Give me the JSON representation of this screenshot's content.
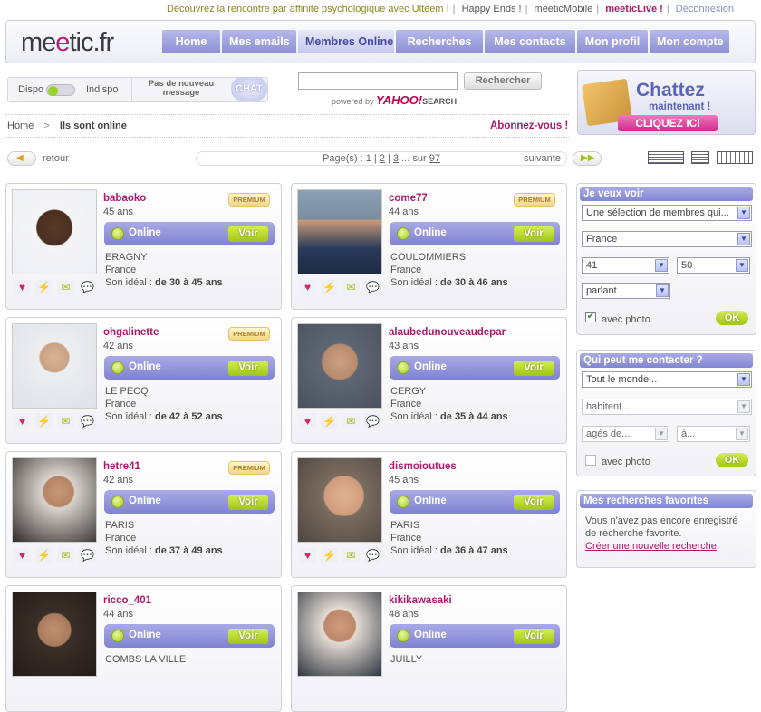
{
  "toplinks": {
    "promo": "Découvrez la rencontre par affinité psychologique avec Ulteem !",
    "happy_ends": "Happy Ends !",
    "mobile": "meeticMobile",
    "live": "meeticLive !",
    "logout": "Déconnexion"
  },
  "logo": {
    "part1": "me",
    "e": "e",
    "part2": "tic.fr"
  },
  "nav": [
    "Home",
    "Mes emails",
    "Membres Online",
    "Recherches",
    "Mes contacts",
    "Mon profil",
    "Mon compte"
  ],
  "status": {
    "dispo": "Dispo",
    "indispo": "Indispo",
    "message": "Pas de nouveau message",
    "chat": "CHAT"
  },
  "search": {
    "button": "Rechercher",
    "powered_by": "powered by",
    "yahoo": "YAHOO!",
    "search_word": "SEARCH"
  },
  "banner": {
    "line1": "Chattez",
    "line2": "maintenant !",
    "cta": "CLIQUEZ ICI"
  },
  "breadcrumb": {
    "home": "Home",
    "sep": ">",
    "current": "Ils sont online"
  },
  "subscribe": "Abonnez-vous !",
  "pager": {
    "back": "retour",
    "pages_label": "Page(s) : 1 |",
    "p2": "2",
    "p3": "3",
    "more": "... sur",
    "total": "97",
    "next": "suivante"
  },
  "cards": [
    {
      "name": "babaoko",
      "age": "45 ans",
      "premium": "PREMIUM",
      "status": "Online",
      "voir": "Voir",
      "city": "ERAGNY",
      "country": "France",
      "ideal_label": "Son idéal :",
      "ideal": "de 30 à 45 ans"
    },
    {
      "name": "come77",
      "age": "44 ans",
      "premium": "PREMIUM",
      "status": "Online",
      "voir": "Voir",
      "city": "COULOMMIERS",
      "country": "France",
      "ideal_label": "Son idéal :",
      "ideal": "de 30 à 46 ans"
    },
    {
      "name": "ohgalinette",
      "age": "42 ans",
      "premium": "PREMIUM",
      "status": "Online",
      "voir": "Voir",
      "city": "LE PECQ",
      "country": "France",
      "ideal_label": "Son idéal :",
      "ideal": "de 42 à 52 ans"
    },
    {
      "name": "alaubedunouveaudepar",
      "age": "43 ans",
      "premium": "",
      "status": "Online",
      "voir": "Voir",
      "city": "CERGY",
      "country": "France",
      "ideal_label": "Son idéal :",
      "ideal": "de 35 à 44 ans"
    },
    {
      "name": "hetre41",
      "age": "42 ans",
      "premium": "PREMIUM",
      "status": "Online",
      "voir": "Voir",
      "city": "PARIS",
      "country": "France",
      "ideal_label": "Son idéal :",
      "ideal": "de 37 à 49 ans"
    },
    {
      "name": "dismoioutues",
      "age": "45 ans",
      "premium": "",
      "status": "Online",
      "voir": "Voir",
      "city": "PARIS",
      "country": "France",
      "ideal_label": "Son idéal :",
      "ideal": "de 36 à 47 ans"
    },
    {
      "name": "ricco_401",
      "age": "44 ans",
      "premium": "",
      "status": "Online",
      "voir": "Voir",
      "city": "COMBS LA VILLE",
      "country": "",
      "ideal_label": "",
      "ideal": ""
    },
    {
      "name": "kikikawasaki",
      "age": "48 ans",
      "premium": "",
      "status": "Online",
      "voir": "Voir",
      "city": "JUILLY",
      "country": "",
      "ideal_label": "",
      "ideal": ""
    }
  ],
  "card_icons": [
    "heart-plus-icon",
    "flash-icon",
    "email-icon",
    "chat-bubble-icon"
  ],
  "sidebar": {
    "jeveux": {
      "title": "Je veux voir",
      "selection": "Une sélection de membres qui...",
      "country": "France",
      "age_min": "41",
      "age_max": "50",
      "lang": "parlant",
      "photo_label": "avec photo",
      "ok": "OK"
    },
    "contact": {
      "title": "Qui peut me contacter ?",
      "who": "Tout le monde...",
      "habitent": "habitent...",
      "ages": "agés de...",
      "a": "à...",
      "photo_label": "avec photo",
      "ok": "OK"
    },
    "favs": {
      "title": "Mes recherches favorites",
      "text1": "Vous n'avez pas encore enregistré",
      "text2": "de recherche favorite.",
      "link": "Créer une nouvelle recherche"
    }
  },
  "colors": {
    "accent": "#8287d2",
    "brand": "#b0186a",
    "green": "#9fc513",
    "olive": "#8a8a1a"
  }
}
